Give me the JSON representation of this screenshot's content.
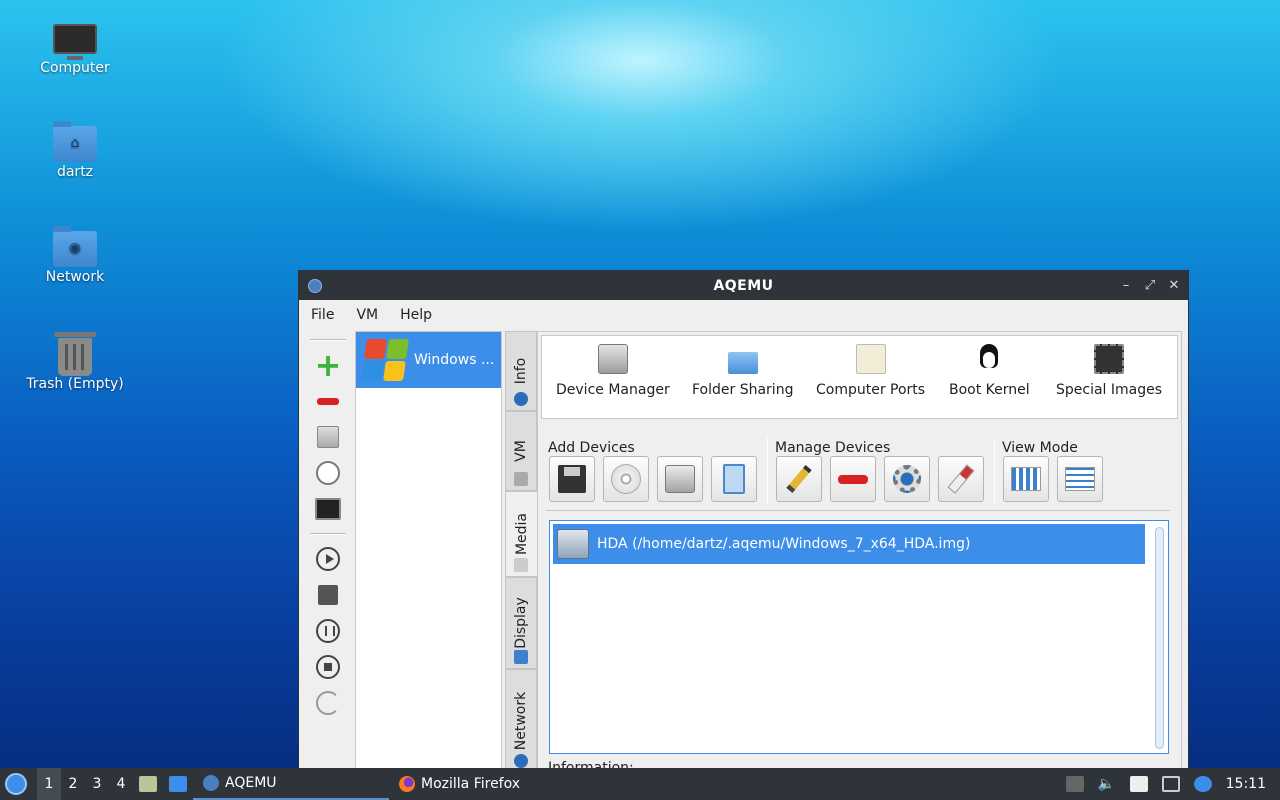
{
  "desktop": {
    "icons": [
      {
        "label": "Computer"
      },
      {
        "label": "dartz"
      },
      {
        "label": "Network"
      },
      {
        "label": "Trash (Empty)"
      }
    ]
  },
  "window": {
    "title": "AQEMU",
    "menu": [
      "File",
      "VM",
      "Help"
    ],
    "vm_list": [
      {
        "name": "Windows ..."
      }
    ],
    "tabs": [
      "Info",
      "VM",
      "Media",
      "Display",
      "Network"
    ],
    "active_tab": "Media",
    "top_items": [
      "Device Manager",
      "Folder Sharing",
      "Computer Ports",
      "Boot Kernel",
      "Special Images"
    ],
    "groups": {
      "add": "Add Devices",
      "manage": "Manage Devices",
      "view": "View Mode"
    },
    "devices": [
      {
        "label": "HDA (/home/dartz/.aqemu/Windows_7_x64_HDA.img)"
      }
    ],
    "information_label": "Information:"
  },
  "taskbar": {
    "workspaces": [
      "1",
      "2",
      "3",
      "4"
    ],
    "active_workspace": "1",
    "tasks": [
      {
        "label": "AQEMU"
      },
      {
        "label": "Mozilla Firefox"
      }
    ],
    "clock": "15:11"
  },
  "colors": {
    "selection": "#3d8ee8",
    "titlebar": "#2f343a",
    "add": "#3bb33b",
    "remove": "#d42222"
  }
}
